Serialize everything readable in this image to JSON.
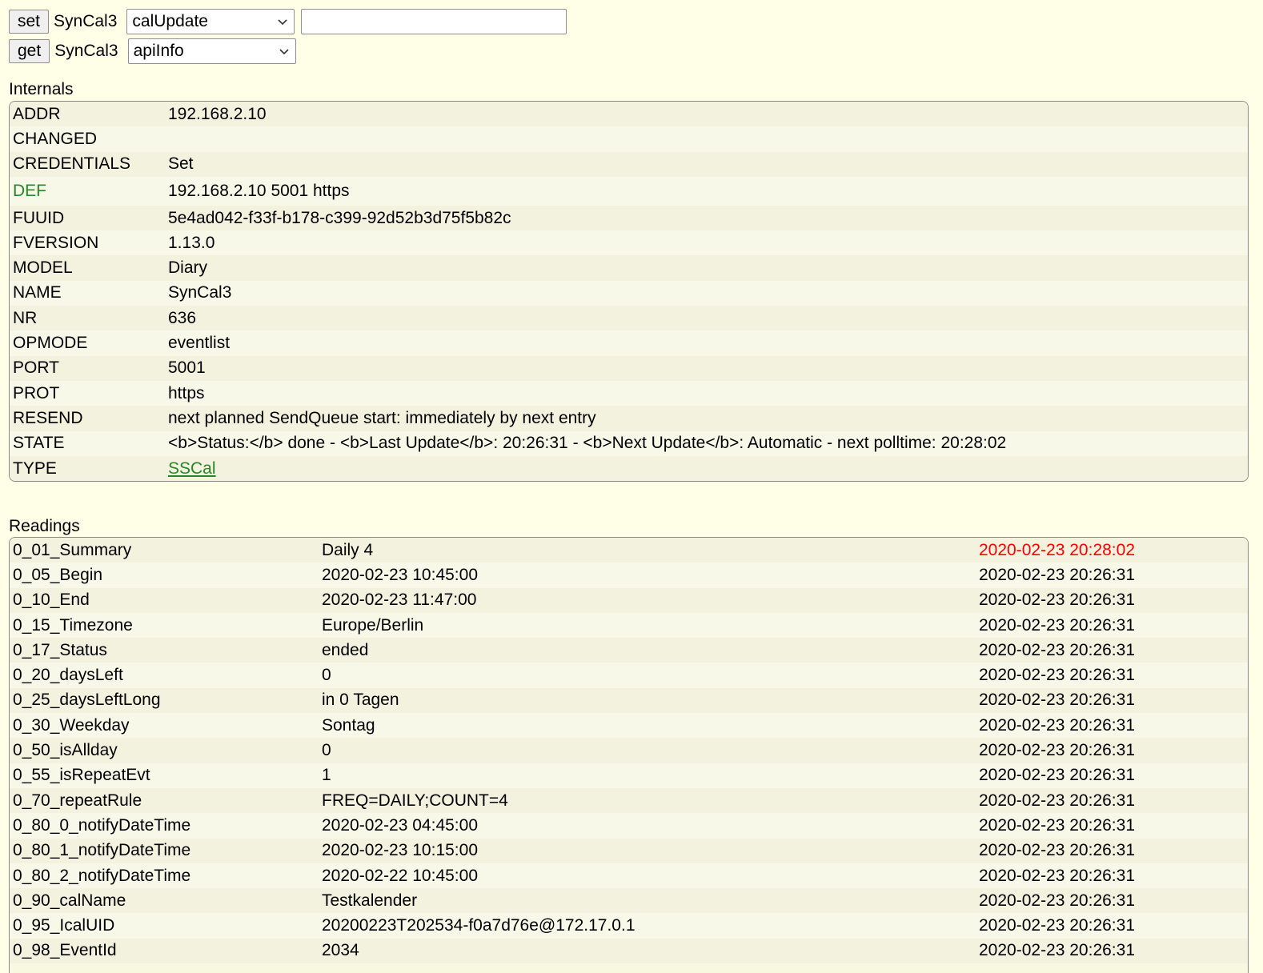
{
  "commands": {
    "set": {
      "button_label": "set",
      "device": "SynCal3",
      "selected": "calUpdate",
      "input_value": ""
    },
    "get": {
      "button_label": "get",
      "device": "SynCal3",
      "selected": "apiInfo"
    }
  },
  "internals": {
    "title": "Internals",
    "rows": [
      {
        "key": "ADDR",
        "value": "192.168.2.10"
      },
      {
        "key": "CHANGED",
        "value": ""
      },
      {
        "key": "CREDENTIALS",
        "value": "Set"
      },
      {
        "key": "DEF",
        "value": "192.168.2.10 5001 https"
      },
      {
        "key": "FUUID",
        "value": "5e4ad042-f33f-b178-c399-92d52b3d75f5b82c"
      },
      {
        "key": "FVERSION",
        "value": "1.13.0"
      },
      {
        "key": "MODEL",
        "value": "Diary"
      },
      {
        "key": "NAME",
        "value": "SynCal3"
      },
      {
        "key": "NR",
        "value": "636"
      },
      {
        "key": "OPMODE",
        "value": "eventlist"
      },
      {
        "key": "PORT",
        "value": "5001"
      },
      {
        "key": "PROT",
        "value": "https"
      },
      {
        "key": "RESEND",
        "value": "next planned SendQueue start: immediately by next entry"
      },
      {
        "key": "STATE",
        "value": "<b>Status:</b> done - <b>Last Update</b>: 20:26:31 - <b>Next Update</b>: Automatic - next polltime: 20:28:02"
      },
      {
        "key": "TYPE",
        "value": "SSCal"
      }
    ]
  },
  "readings": {
    "title": "Readings",
    "rows": [
      {
        "key": "0_01_Summary",
        "value": "Daily 4",
        "time": "2020-02-23 20:28:02"
      },
      {
        "key": "0_05_Begin",
        "value": "2020-02-23 10:45:00",
        "time": "2020-02-23 20:26:31"
      },
      {
        "key": "0_10_End",
        "value": "2020-02-23 11:47:00",
        "time": "2020-02-23 20:26:31"
      },
      {
        "key": "0_15_Timezone",
        "value": "Europe/Berlin",
        "time": "2020-02-23 20:26:31"
      },
      {
        "key": "0_17_Status",
        "value": "ended",
        "time": "2020-02-23 20:26:31"
      },
      {
        "key": "0_20_daysLeft",
        "value": "0",
        "time": "2020-02-23 20:26:31"
      },
      {
        "key": "0_25_daysLeftLong",
        "value": "in 0 Tagen",
        "time": "2020-02-23 20:26:31"
      },
      {
        "key": "0_30_Weekday",
        "value": "Sontag",
        "time": "2020-02-23 20:26:31"
      },
      {
        "key": "0_50_isAllday",
        "value": "0",
        "time": "2020-02-23 20:26:31"
      },
      {
        "key": "0_55_isRepeatEvt",
        "value": "1",
        "time": "2020-02-23 20:26:31"
      },
      {
        "key": "0_70_repeatRule",
        "value": "FREQ=DAILY;COUNT=4",
        "time": "2020-02-23 20:26:31"
      },
      {
        "key": "0_80_0_notifyDateTime",
        "value": "2020-02-23 04:45:00",
        "time": "2020-02-23 20:26:31"
      },
      {
        "key": "0_80_1_notifyDateTime",
        "value": "2020-02-23 10:15:00",
        "time": "2020-02-23 20:26:31"
      },
      {
        "key": "0_80_2_notifyDateTime",
        "value": "2020-02-22 10:45:00",
        "time": "2020-02-23 20:26:31"
      },
      {
        "key": "0_90_calName",
        "value": "Testkalender",
        "time": "2020-02-23 20:26:31"
      },
      {
        "key": "0_95_IcalUID",
        "value": "20200223T202534-f0a7d76e@172.17.0.1",
        "time": "2020-02-23 20:26:31"
      },
      {
        "key": "0_98_EventId",
        "value": "2034",
        "time": "2020-02-23 20:26:31"
      }
    ]
  },
  "colors": {
    "background": "#ffffe7",
    "link_green": "#278727",
    "recent_red": "#ff0000"
  }
}
